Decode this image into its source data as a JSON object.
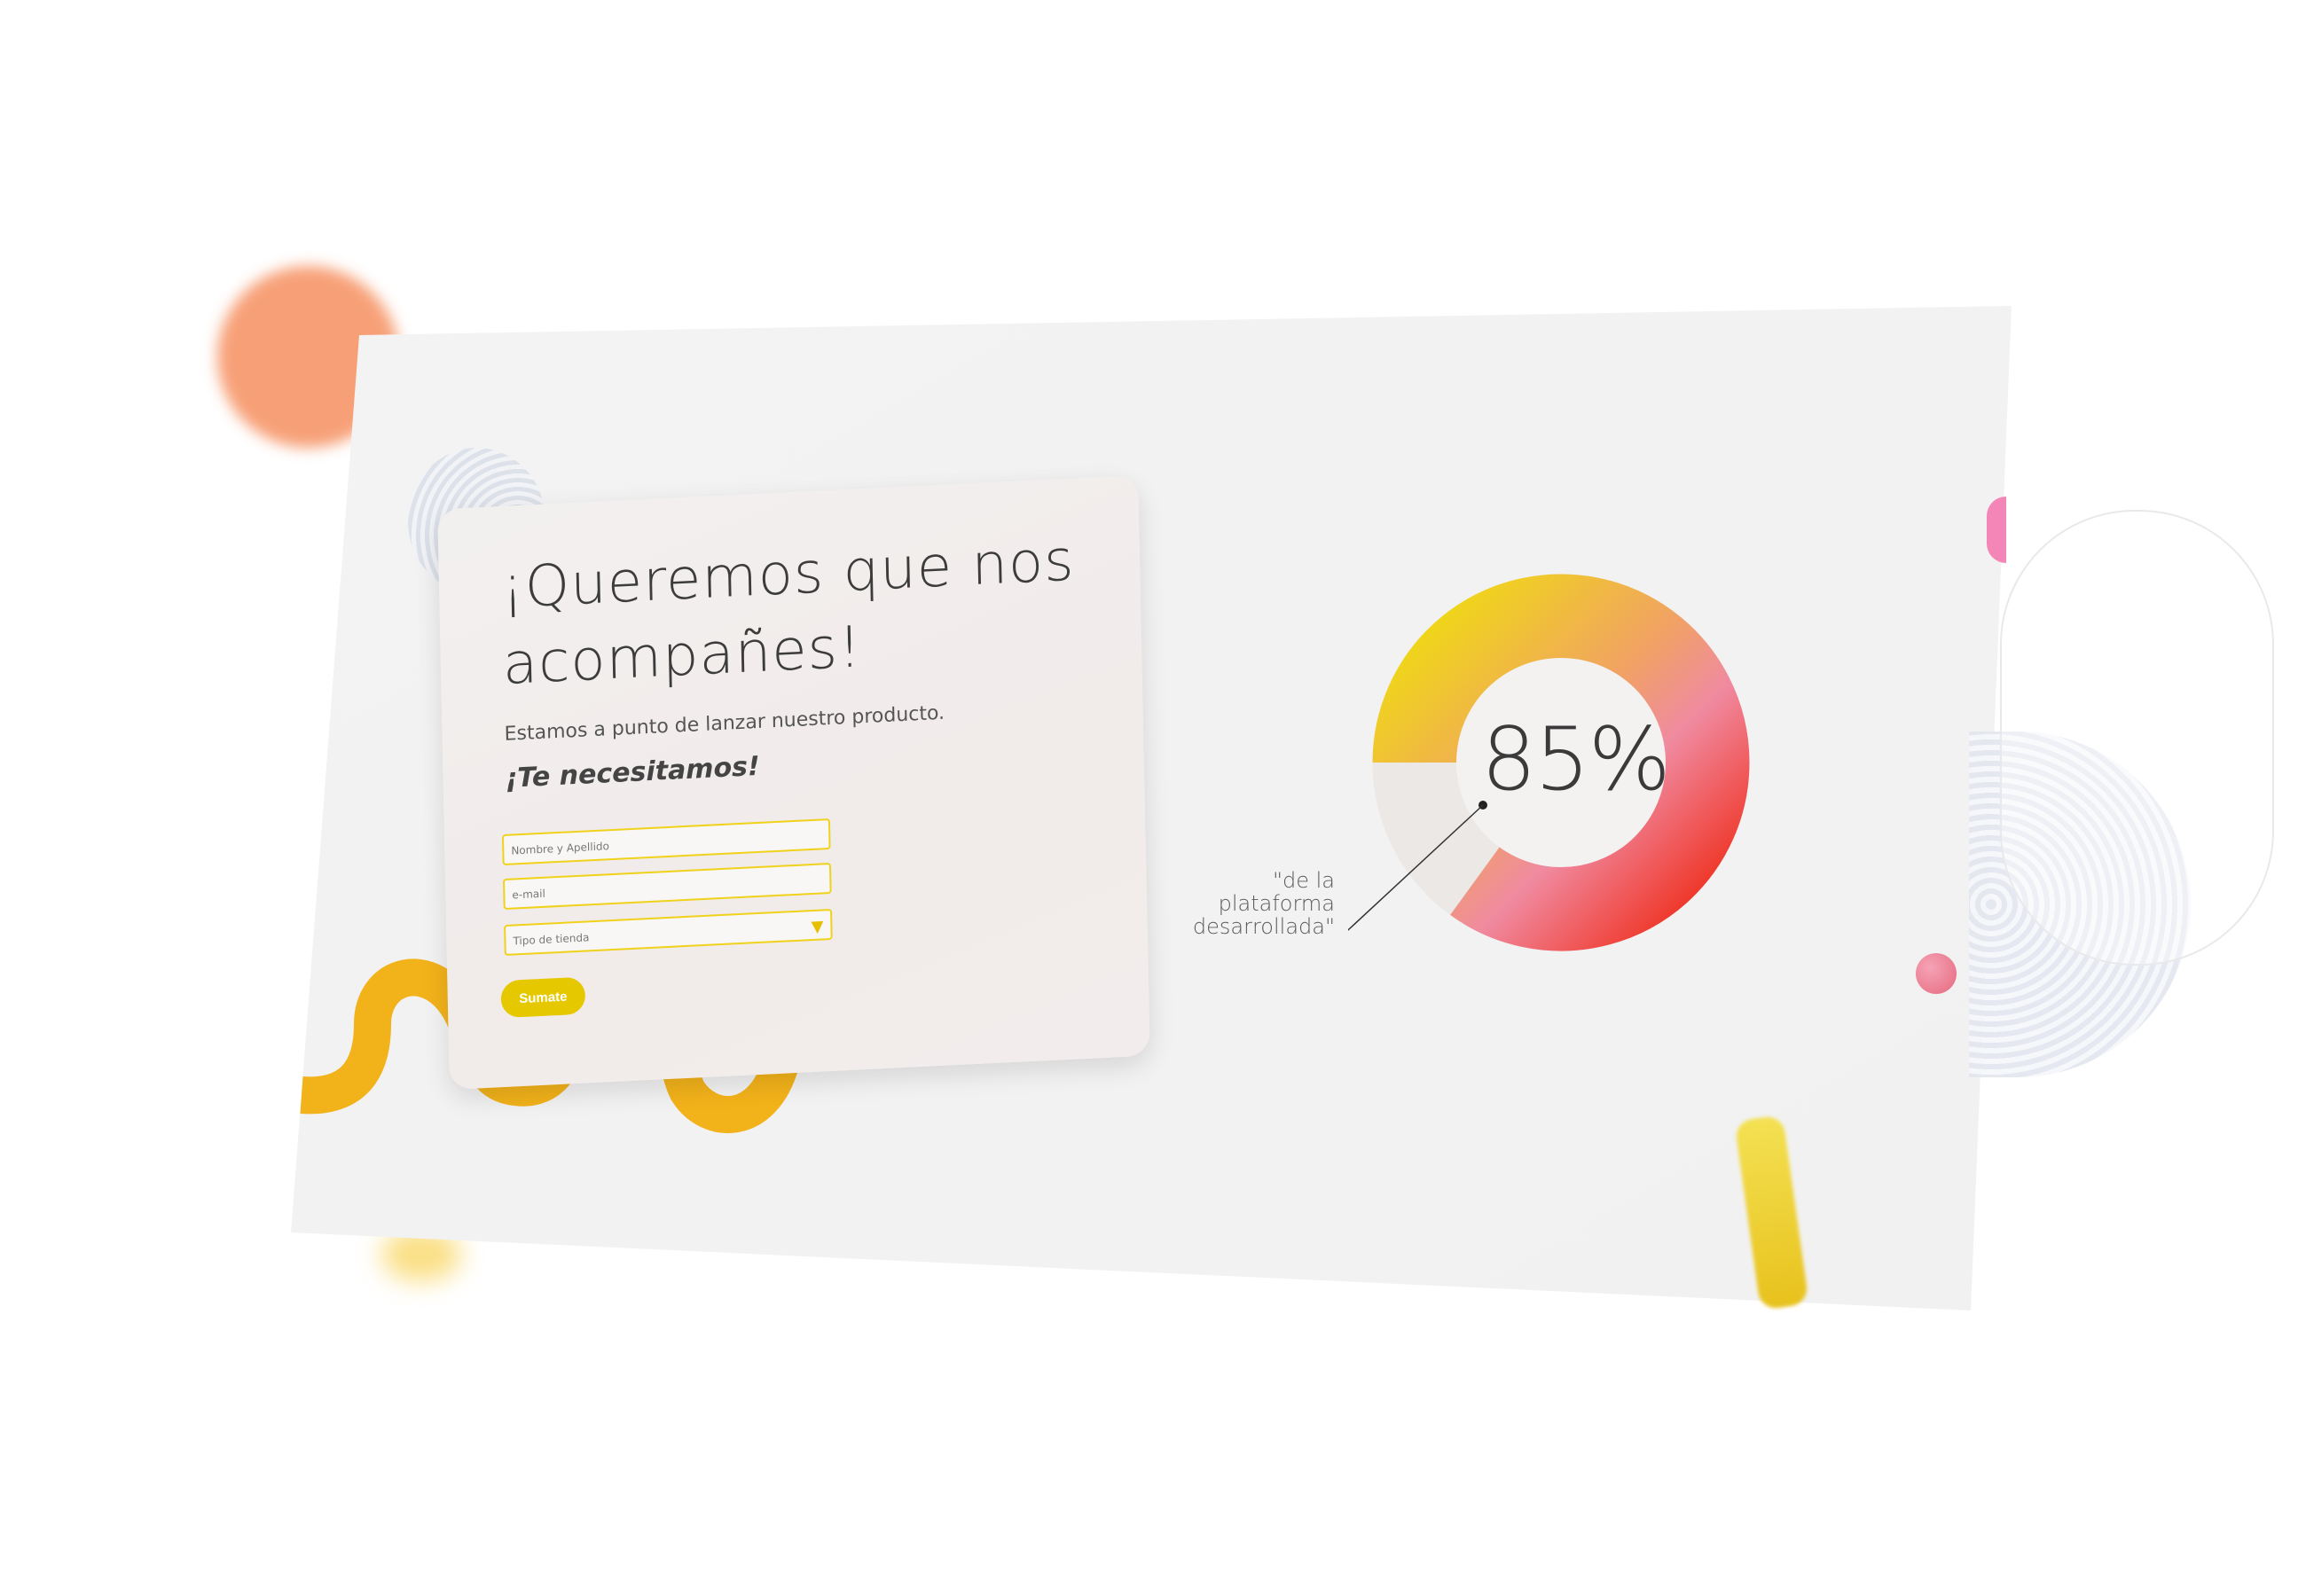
{
  "form": {
    "headline": "¡Queremos que nos acompañes!",
    "subtitle": "Estamos a punto de lanzar nuestro producto.",
    "cta": "¡Te necesitamos!",
    "name_placeholder": "Nombre y Apellido",
    "email_placeholder": "e-mail",
    "store_placeholder": "Tipo de tienda",
    "submit_label": "Sumate"
  },
  "stat": {
    "value": "85%",
    "percent": 85,
    "caption": "\"de la plataforma desarrollada\""
  },
  "colors": {
    "accent_yellow": "#e6c800",
    "wave_orange": "#f2b21a",
    "donut_start": "#efdb12",
    "donut_mid": "#f08aa0",
    "donut_end": "#ef2d1b"
  }
}
